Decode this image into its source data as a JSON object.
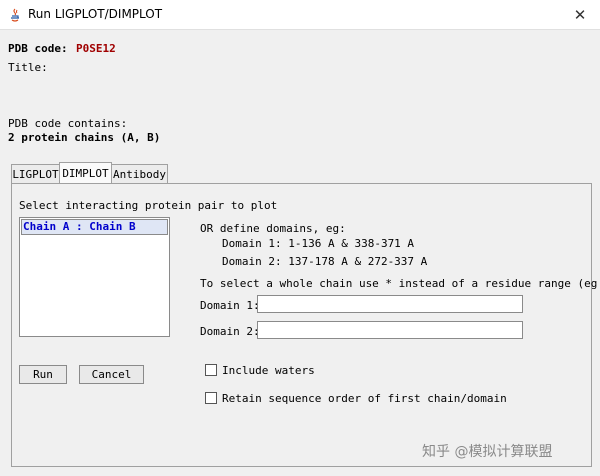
{
  "window": {
    "title": "Run LIGPLOT/DIMPLOT",
    "close_glyph": "✕"
  },
  "pdb": {
    "code_label": "PDB code:",
    "code_value": "P0SE12",
    "title_label": "Title:",
    "contains_label": "PDB code contains:",
    "chains_text": "2 protein chains (A, B)"
  },
  "tabs": [
    {
      "label": "LIGPLOT",
      "active": false
    },
    {
      "label": "DIMPLOT",
      "active": true
    },
    {
      "label": "Antibody",
      "active": false
    }
  ],
  "dimplot": {
    "select_label": "Select interacting protein pair to plot",
    "pairs": [
      "Chain A : Chain B"
    ],
    "define_label": "OR define domains, eg:",
    "example1": "Domain 1: 1-136 A & 338-371 A",
    "example2": "Domain 2: 137-178 A & 272-337 A",
    "whole_chain_hint": "To select a whole chain use * instead of a residue range (eg *A)",
    "domain1_label": "Domain 1:",
    "domain1_value": "",
    "domain2_label": "Domain 2:",
    "domain2_value": "",
    "run_label": "Run",
    "cancel_label": "Cancel",
    "include_waters_label": "Include waters",
    "retain_order_label": "Retain sequence order of first chain/domain"
  },
  "watermark": "知乎 @模拟计算联盟",
  "colors": {
    "pdb_code": "#a00000",
    "pair_text": "#0000cc",
    "background": "#f0f0f0"
  }
}
